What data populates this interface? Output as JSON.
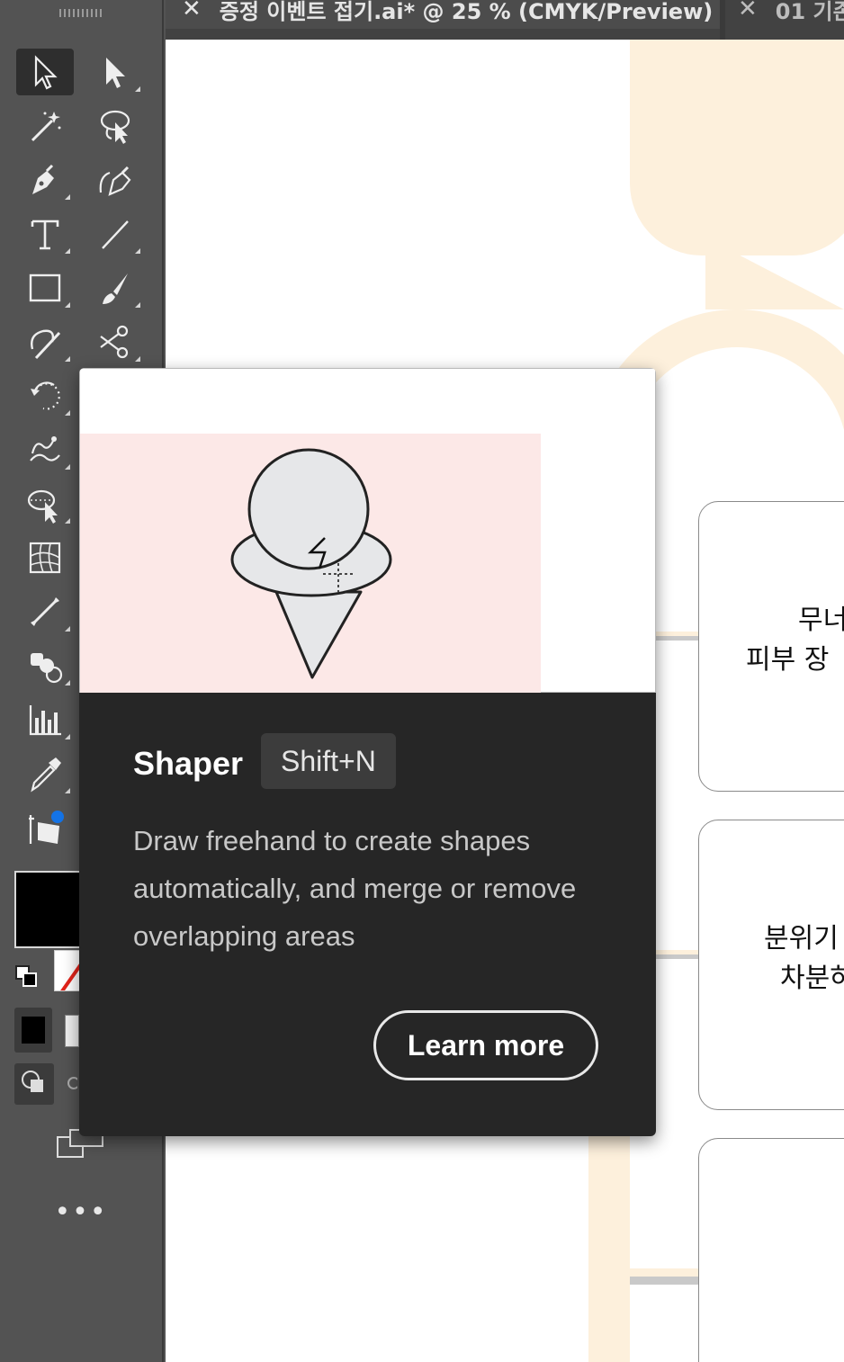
{
  "document_tabs": [
    {
      "title": "증정 이벤트 접기.ai* @ 25 % (CMYK/Preview)",
      "close_icon": "close-icon",
      "active": true
    },
    {
      "title": "01 기존",
      "close_icon": "close-icon",
      "active": false
    }
  ],
  "toolbar": {
    "tools": [
      {
        "name": "selection-tool",
        "icon": "selection-arrow-icon",
        "active": true
      },
      {
        "name": "direct-selection-tool",
        "icon": "direct-selection-arrow-icon"
      },
      {
        "name": "magic-wand-tool",
        "icon": "magic-wand-icon"
      },
      {
        "name": "lasso-tool",
        "icon": "lasso-icon"
      },
      {
        "name": "pen-tool",
        "icon": "pen-icon"
      },
      {
        "name": "curvature-tool",
        "icon": "curvature-pen-icon"
      },
      {
        "name": "type-tool",
        "icon": "type-icon"
      },
      {
        "name": "line-segment-tool",
        "icon": "line-icon"
      },
      {
        "name": "rectangle-tool",
        "icon": "rectangle-icon"
      },
      {
        "name": "paintbrush-tool",
        "icon": "paintbrush-icon"
      },
      {
        "name": "shaper-tool",
        "icon": "shaper-icon"
      },
      {
        "name": "scissors-tool",
        "icon": "scissors-icon"
      },
      {
        "name": "rotate-tool",
        "icon": "rotate-icon"
      },
      {
        "name": "warp-tool",
        "icon": "warp-icon"
      },
      {
        "name": "free-transform-tool",
        "icon": "free-transform-icon"
      },
      {
        "name": "mesh-tool",
        "icon": "mesh-icon"
      },
      {
        "name": "blend-tool",
        "icon": "blend-icon"
      },
      {
        "name": "symbol-sprayer-tool",
        "icon": "symbol-sprayer-icon"
      },
      {
        "name": "column-graph-tool",
        "icon": "column-graph-icon"
      },
      {
        "name": "eyedropper-tool",
        "icon": "eyedropper-icon"
      },
      {
        "name": "artboard-tool",
        "icon": "artboard-icon"
      }
    ],
    "more_label": "•••",
    "fill_color": "#000000",
    "stroke_color": "none"
  },
  "tooltip": {
    "title": "Shaper",
    "shortcut": "Shift+N",
    "description": "Draw freehand to create shapes automatically, and merge or remove overlapping areas",
    "button_label": "Learn more",
    "illustration": "ice-cream-cone-shaper-icon"
  },
  "canvas": {
    "cards": [
      {
        "lines": [
          "무너",
          "피부 장"
        ]
      },
      {
        "lines": [
          "분위기",
          "차분하"
        ]
      },
      {
        "lines": []
      }
    ],
    "accent_color": "#fdf0dc"
  }
}
